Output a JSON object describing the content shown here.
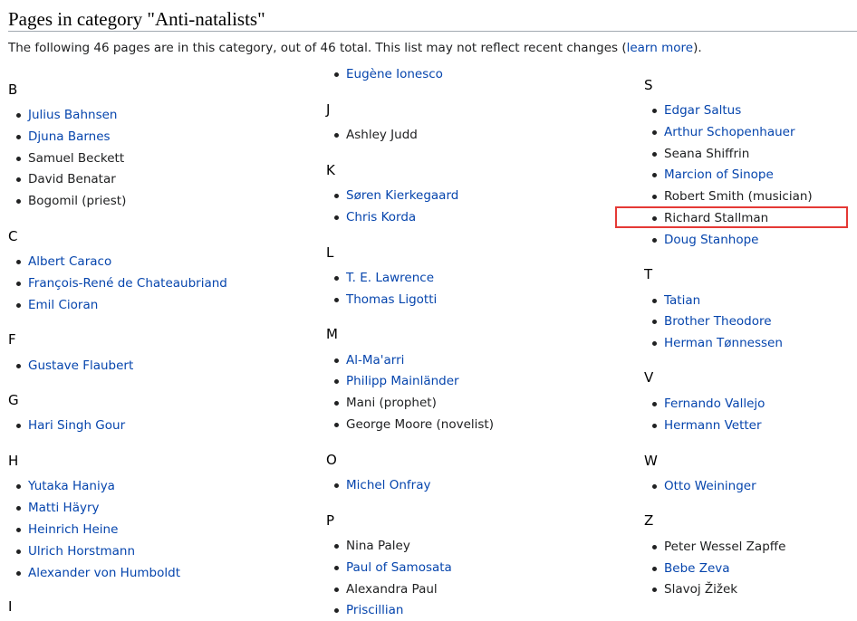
{
  "heading": "Pages in category \"Anti-natalists\"",
  "intro": {
    "text_before": "The following 46 pages are in this category, out of 46 total. This list may not reflect recent changes (",
    "link": "learn more",
    "text_after": ")."
  },
  "groups": [
    {
      "letter": "B",
      "items": [
        {
          "label": "Julius Bahnsen",
          "link": true
        },
        {
          "label": "Djuna Barnes",
          "link": true
        },
        {
          "label": "Samuel Beckett",
          "link": false
        },
        {
          "label": "David Benatar",
          "link": false
        },
        {
          "label": "Bogomil (priest)",
          "link": false
        }
      ]
    },
    {
      "letter": "C",
      "items": [
        {
          "label": "Albert Caraco",
          "link": true
        },
        {
          "label": "François-René de Chateaubriand",
          "link": true
        },
        {
          "label": "Emil Cioran",
          "link": true
        }
      ]
    },
    {
      "letter": "F",
      "items": [
        {
          "label": "Gustave Flaubert",
          "link": true
        }
      ]
    },
    {
      "letter": "G",
      "items": [
        {
          "label": "Hari Singh Gour",
          "link": true
        }
      ]
    },
    {
      "letter": "H",
      "items": [
        {
          "label": "Yutaka Haniya",
          "link": true
        },
        {
          "label": "Matti Häyry",
          "link": true
        },
        {
          "label": "Heinrich Heine",
          "link": true
        },
        {
          "label": "Ulrich Horstmann",
          "link": true
        },
        {
          "label": "Alexander von Humboldt",
          "link": true
        }
      ]
    },
    {
      "letter": "I",
      "items": [
        {
          "label": "Eugène Ionesco",
          "link": true
        }
      ]
    },
    {
      "letter": "J",
      "items": [
        {
          "label": "Ashley Judd",
          "link": false
        }
      ]
    },
    {
      "letter": "K",
      "items": [
        {
          "label": "Søren Kierkegaard",
          "link": true
        },
        {
          "label": "Chris Korda",
          "link": true
        }
      ]
    },
    {
      "letter": "L",
      "items": [
        {
          "label": "T. E. Lawrence",
          "link": true
        },
        {
          "label": "Thomas Ligotti",
          "link": true
        }
      ]
    },
    {
      "letter": "M",
      "items": [
        {
          "label": "Al-Ma'arri",
          "link": true
        },
        {
          "label": "Philipp Mainländer",
          "link": true
        },
        {
          "label": "Mani (prophet)",
          "link": false
        },
        {
          "label": "George Moore (novelist)",
          "link": false
        }
      ]
    },
    {
      "letter": "O",
      "items": [
        {
          "label": "Michel Onfray",
          "link": true
        }
      ]
    },
    {
      "letter": "P",
      "items": [
        {
          "label": "Nina Paley",
          "link": false
        },
        {
          "label": "Paul of Samosata",
          "link": true
        },
        {
          "label": "Alexandra Paul",
          "link": false
        },
        {
          "label": "Priscillian",
          "link": true
        }
      ]
    },
    {
      "letter": "S",
      "items": [
        {
          "label": "Edgar Saltus",
          "link": true
        },
        {
          "label": "Arthur Schopenhauer",
          "link": true
        },
        {
          "label": "Seana Shiffrin",
          "link": false
        },
        {
          "label": "Marcion of Sinope",
          "link": true
        },
        {
          "label": "Robert Smith (musician)",
          "link": false
        },
        {
          "label": "Richard Stallman",
          "link": false
        },
        {
          "label": "Doug Stanhope",
          "link": true
        }
      ]
    },
    {
      "letter": "T",
      "items": [
        {
          "label": "Tatian",
          "link": true
        },
        {
          "label": "Brother Theodore",
          "link": true
        },
        {
          "label": "Herman Tønnessen",
          "link": true
        }
      ]
    },
    {
      "letter": "V",
      "items": [
        {
          "label": "Fernando Vallejo",
          "link": true
        },
        {
          "label": "Hermann Vetter",
          "link": true
        }
      ]
    },
    {
      "letter": "W",
      "items": [
        {
          "label": "Otto Weininger",
          "link": true
        }
      ]
    },
    {
      "letter": "Z",
      "items": [
        {
          "label": "Peter Wessel Zapffe",
          "link": false
        },
        {
          "label": "Bebe Zeva",
          "link": true
        },
        {
          "label": "Slavoj Žižek",
          "link": false
        }
      ]
    }
  ]
}
